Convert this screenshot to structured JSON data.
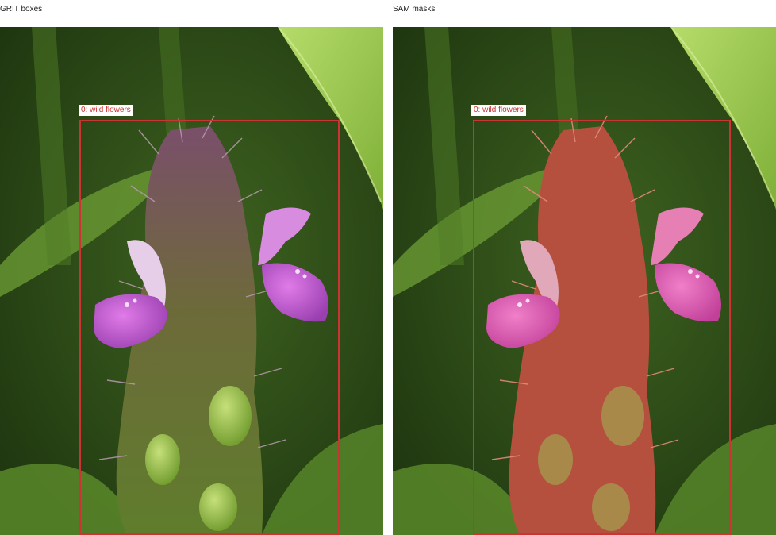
{
  "panels": {
    "left": {
      "title": "GRIT boxes"
    },
    "right": {
      "title": "SAM masks"
    }
  },
  "detections": [
    {
      "label": "0: wild flowers"
    }
  ],
  "colors": {
    "box": "#cc3333",
    "mask": "#d94a4a",
    "petal": "#c25ad0",
    "leaf": "#9acb4a",
    "background": "#2c4a16"
  },
  "scene": {
    "subject": "wild flower with purple petals and hairy green stem",
    "background": "blurred green foliage"
  }
}
